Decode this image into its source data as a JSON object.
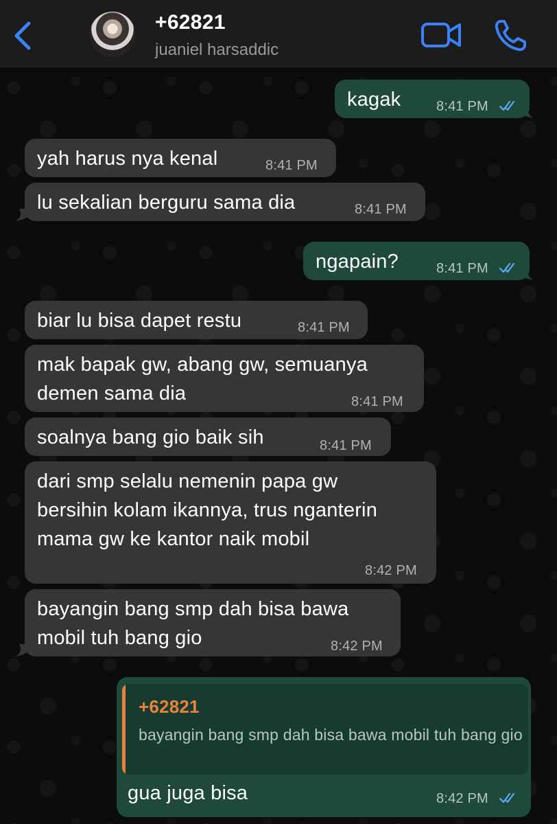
{
  "header": {
    "contact_name": "+62821",
    "contact_subtitle": "juaniel harsaddic",
    "icons": {
      "back": "chevron-left-icon",
      "video": "video-camera-icon",
      "call": "phone-icon"
    },
    "accent_color": "#3b82f6"
  },
  "messages": [
    {
      "direction": "out",
      "text": "kagak",
      "time": "8:41 PM",
      "status": "read"
    },
    {
      "direction": "in",
      "text": "yah harus nya kenal",
      "time": "8:41 PM"
    },
    {
      "direction": "in",
      "text": "lu sekalian berguru sama dia",
      "time": "8:41 PM"
    },
    {
      "direction": "out",
      "text": "ngapain?",
      "time": "8:41 PM",
      "status": "read"
    },
    {
      "direction": "in",
      "text": "biar lu bisa dapet restu",
      "time": "8:41 PM"
    },
    {
      "direction": "in",
      "text": "mak bapak gw, abang gw, semuanya\ndemen sama dia",
      "time": "8:41 PM"
    },
    {
      "direction": "in",
      "text": "soalnya bang gio baik sih",
      "time": "8:41 PM"
    },
    {
      "direction": "in",
      "text": "dari smp selalu nemenin papa gw\nbersihin kolam ikannya, trus nganterin\nmama gw ke kantor naik mobil",
      "time": "8:42 PM"
    },
    {
      "direction": "in",
      "text": "bayangin bang smp dah bisa bawa\nmobil tuh bang gio",
      "time": "8:42 PM"
    },
    {
      "direction": "out",
      "text": "gua juga bisa",
      "time": "8:42 PM",
      "status": "read",
      "reply_to": {
        "name": "+62821",
        "text": "bayangin bang smp dah bisa bawa mobil tuh bang gio"
      }
    }
  ],
  "colors": {
    "incoming_bubble": "#363638",
    "outgoing_bubble": "#1f4a3a",
    "read_ticks": "#5aa9ff",
    "quote_accent": "#e9833c"
  }
}
